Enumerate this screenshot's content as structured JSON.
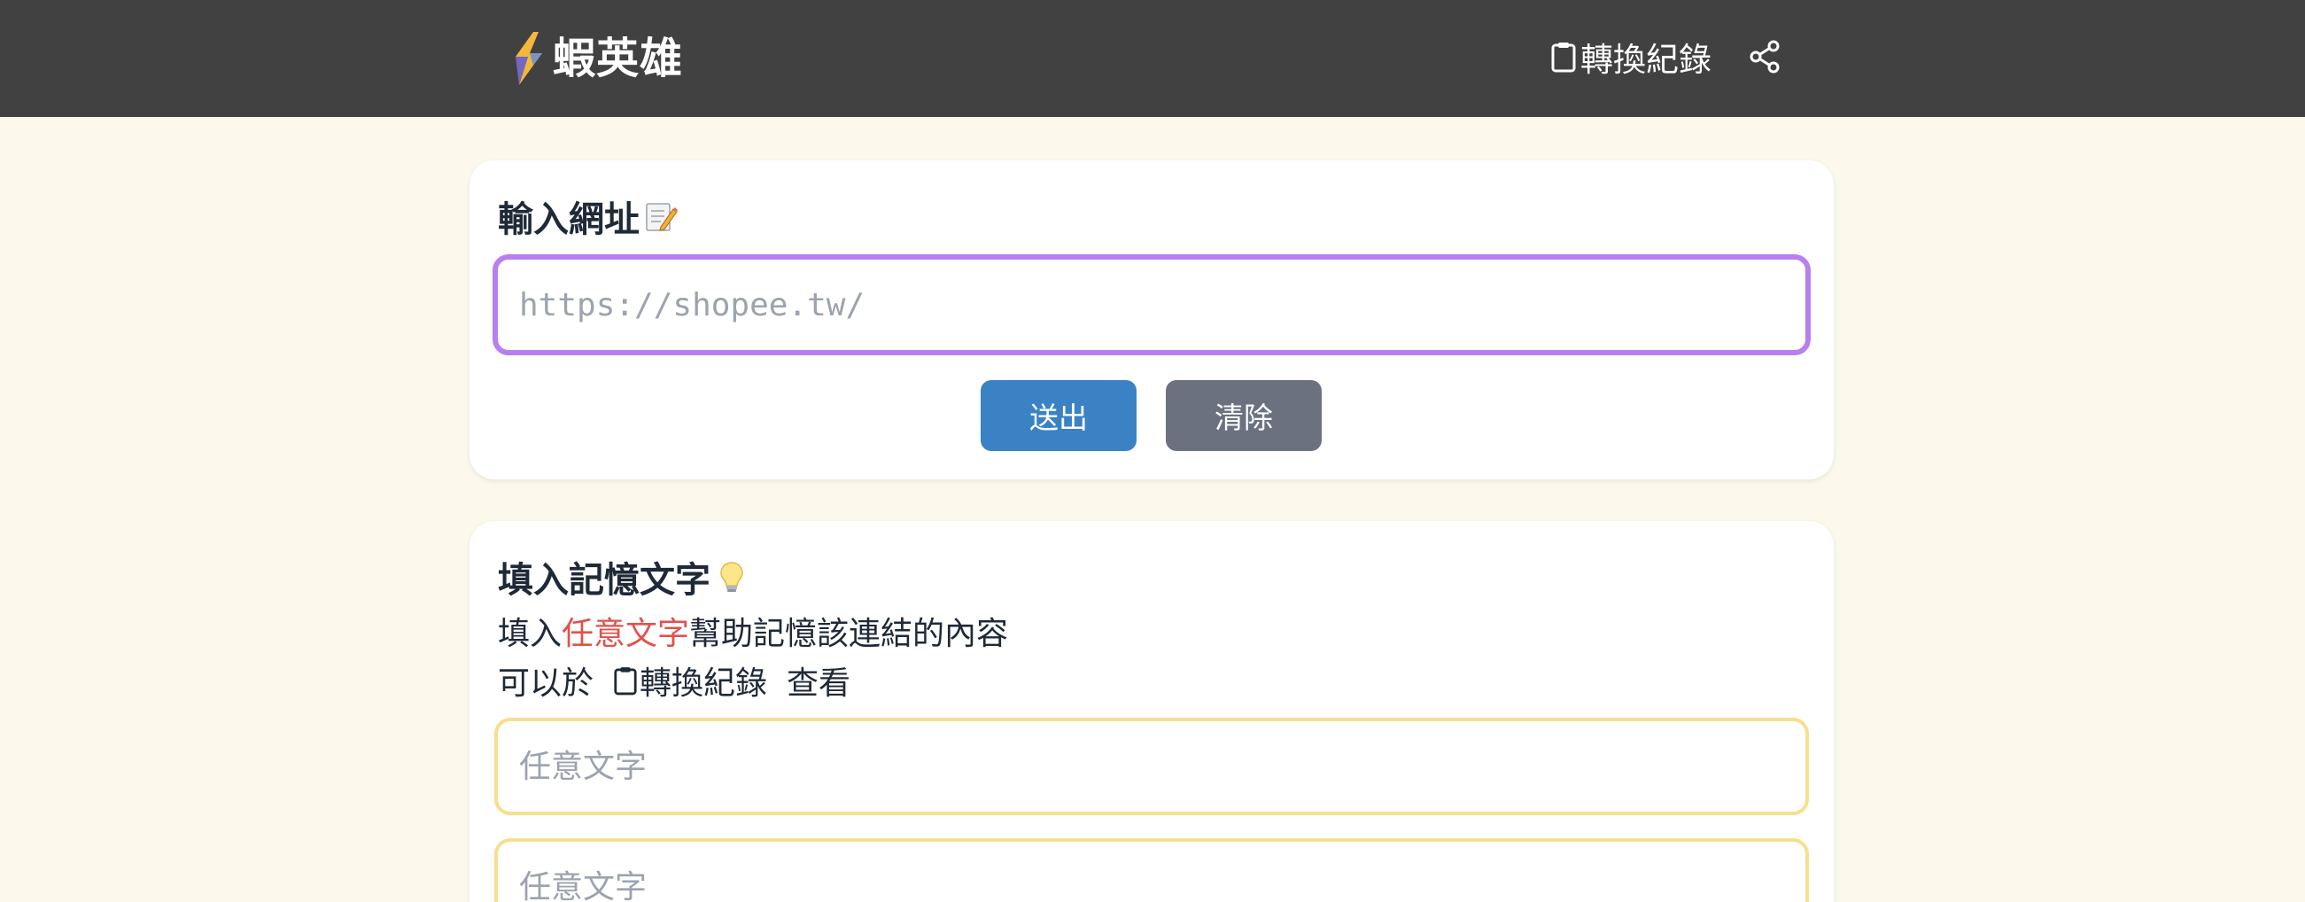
{
  "header": {
    "brand_name": "蝦英雄",
    "history_label": "轉換紀錄",
    "logo_icon": "lightning-bolt-logo",
    "history_icon": "clipboard-icon",
    "share_icon": "share-icon"
  },
  "url_card": {
    "title": "輸入網址",
    "title_icon": "memo-pencil-icon",
    "url_placeholder": "https://shopee.tw/",
    "url_value": "",
    "submit_label": "送出",
    "clear_label": "清除"
  },
  "memo_card": {
    "title": "填入記憶文字",
    "title_icon": "light-bulb-icon",
    "desc_prefix": "填入",
    "desc_highlight": "任意文字",
    "desc_suffix": "幫助記憶該連結的內容",
    "desc2_prefix": "可以於",
    "desc2_link": "轉換紀錄",
    "desc2_suffix": "查看",
    "inputs": [
      {
        "placeholder": "任意文字",
        "value": ""
      },
      {
        "placeholder": "任意文字",
        "value": ""
      }
    ]
  },
  "colors": {
    "topbar_bg": "#414141",
    "page_bg": "#fdf8ec",
    "submit_btn": "#3a82c4",
    "clear_btn": "#6b717f",
    "url_input_border": "#b77ff0",
    "memo_input_border": "#f7df8e",
    "highlight_text": "#e0524d"
  }
}
